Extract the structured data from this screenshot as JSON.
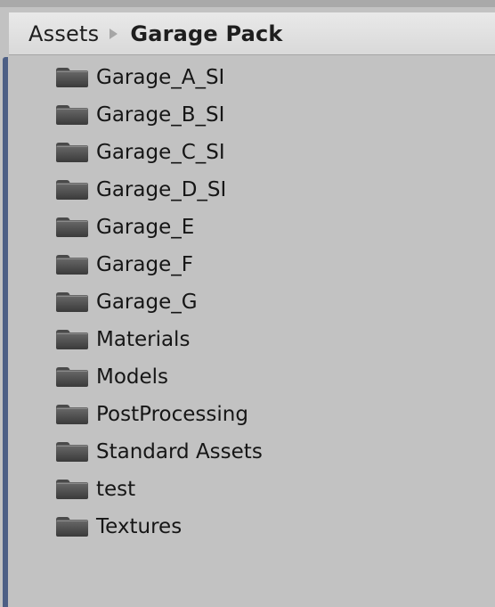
{
  "breadcrumb": {
    "root": "Assets",
    "current": "Garage Pack"
  },
  "folders": [
    {
      "label": "Garage_A_SI",
      "icon": "folder-icon"
    },
    {
      "label": "Garage_B_SI",
      "icon": "folder-icon"
    },
    {
      "label": "Garage_C_SI",
      "icon": "folder-icon"
    },
    {
      "label": "Garage_D_SI",
      "icon": "folder-icon"
    },
    {
      "label": "Garage_E",
      "icon": "folder-icon"
    },
    {
      "label": "Garage_F",
      "icon": "folder-icon"
    },
    {
      "label": "Garage_G",
      "icon": "folder-icon"
    },
    {
      "label": "Materials",
      "icon": "folder-icon"
    },
    {
      "label": "Models",
      "icon": "folder-icon"
    },
    {
      "label": "PostProcessing",
      "icon": "folder-icon"
    },
    {
      "label": "Standard Assets",
      "icon": "folder-icon"
    },
    {
      "label": "test",
      "icon": "folder-icon"
    },
    {
      "label": "Textures",
      "icon": "folder-icon"
    }
  ],
  "colors": {
    "panel_background": "#c2c2c2",
    "breadcrumb_background": "#e2e2e2",
    "folder_icon": "#4a4a4a",
    "left_accent": "#4d5f85"
  }
}
